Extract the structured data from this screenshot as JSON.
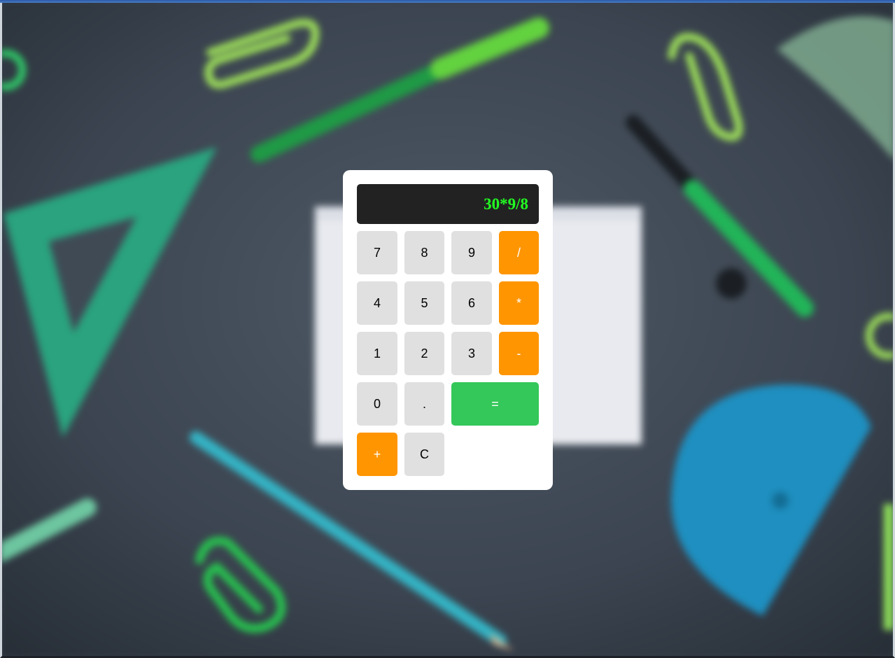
{
  "display": {
    "expression": "30*9/8"
  },
  "keys": {
    "seven": "7",
    "eight": "8",
    "nine": "9",
    "divide": "/",
    "four": "4",
    "five": "5",
    "six": "6",
    "multiply": "*",
    "one": "1",
    "two": "2",
    "three": "3",
    "subtract": "-",
    "zero": "0",
    "decimal": ".",
    "equals": "=",
    "add": "+",
    "clear": "C"
  },
  "colors": {
    "display_background": "#222222",
    "display_text": "#22ff22",
    "digit_key": "#e0e0e0",
    "operator_key": "#ff9500",
    "equals_key": "#34c759",
    "panel": "#ffffff"
  },
  "background": {
    "description_icons": [
      "triangle-ruler-icon",
      "paper-clip-icon",
      "pen-icon",
      "compass-icon",
      "protractor-icon",
      "pencil-icon",
      "notepad-icon"
    ]
  }
}
